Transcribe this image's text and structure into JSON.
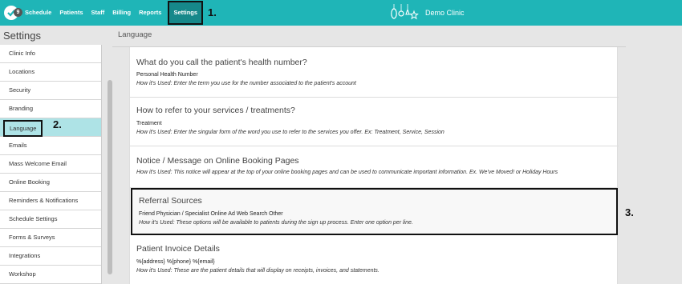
{
  "topbar": {
    "badge_count": "9",
    "nav": [
      "Schedule",
      "Patients",
      "Staff",
      "Billing",
      "Reports",
      "Settings"
    ],
    "clinic_name": "Demo Clinic"
  },
  "annotations": [
    "1.",
    "2.",
    "3."
  ],
  "sidebar": {
    "title": "Settings",
    "items": [
      "Clinic Info",
      "Locations",
      "Security",
      "Branding",
      "Language",
      "Emails",
      "Mass Welcome Email",
      "Online Booking",
      "Reminders & Notifications",
      "Schedule Settings",
      "Forms & Surveys",
      "Integrations",
      "Workshop"
    ]
  },
  "main": {
    "title": "Language",
    "sections": [
      {
        "title": "What do you call the patient's health number?",
        "value": "Personal Health Number",
        "how": "How it's Used: Enter the term you use for the number associated to the patient's account"
      },
      {
        "title": "How to refer to your services / treatments?",
        "value": "Treatment",
        "how": "How it's Used: Enter the singular form of the word you use to refer to the services you offer. Ex: Treatment, Service, Session"
      },
      {
        "title": "Notice / Message on Online Booking Pages",
        "value": "",
        "how": "How it's Used: This notice will appear at the top of your online booking pages and can be used to communicate important information. Ex. We've Moved! or Holiday Hours"
      },
      {
        "title": "Referral Sources",
        "value": "Friend Physician / Specialist Online Ad Web Search Other",
        "how": "How it's Used: These options will be available to patients during the sign up process. Enter one option per line."
      },
      {
        "title": "Patient Invoice Details",
        "value": "%{address} %{phone} %{email}",
        "how": "How it's Used: These are the patient details that will display on receipts, invoices, and statements."
      }
    ]
  },
  "colors": {
    "topbar": "#1fb5b7",
    "active_nav": "#16888a",
    "active_sidebar": "#aee3e6"
  }
}
